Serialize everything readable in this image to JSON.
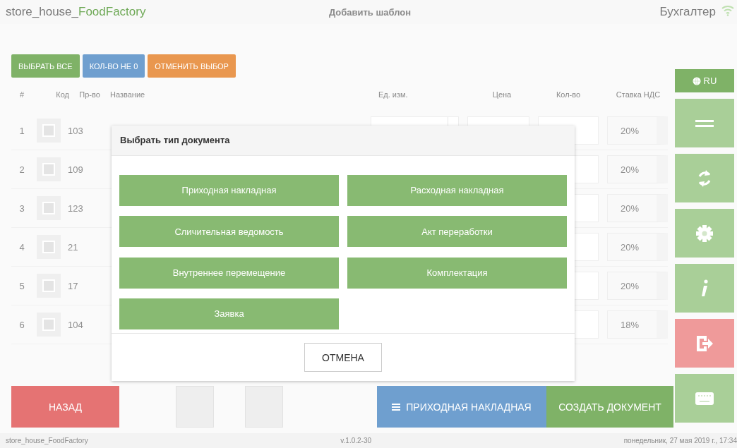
{
  "header": {
    "brand": "store_house_",
    "brand_accent": "FoodFactory",
    "title": "Добавить шаблон",
    "user": "Бухгалтер"
  },
  "toolbar": [
    {
      "label": "ВЫБРАТЬ ВСЕ",
      "color": "#7fb267"
    },
    {
      "label": "КОЛ-ВО НЕ 0",
      "color": "#6f9fcf"
    },
    {
      "label": "ОТМЕНИТЬ ВЫБОР",
      "color": "#e9974f"
    }
  ],
  "language": "RU",
  "table": {
    "columns": [
      "#",
      "Код",
      "Пр-во",
      "Название",
      "Ед. изм.",
      "Цена",
      "Кол-во",
      "Ставка НДС"
    ],
    "rows": [
      {
        "num": "1",
        "checked": false,
        "code": "103",
        "vat": "20%"
      },
      {
        "num": "2",
        "checked": false,
        "code": "109",
        "vat": "20%"
      },
      {
        "num": "3",
        "checked": false,
        "code": "123",
        "vat": "20%"
      },
      {
        "num": "4",
        "checked": false,
        "code": "21",
        "vat": "20%"
      },
      {
        "num": "5",
        "checked": false,
        "code": "17",
        "vat": "20%"
      },
      {
        "num": "6",
        "checked": false,
        "code": "104",
        "vat": "18%"
      }
    ]
  },
  "bottom_bar": {
    "back": "НАЗАД",
    "doc_type": "ПРИХОДНАЯ НАКЛАДНАЯ",
    "create": "СОЗДАТЬ ДОКУМЕНТ"
  },
  "dialog": {
    "title": "Выбрать тип документа",
    "options": [
      "Приходная накладная",
      "Расходная накладная",
      "Сличительная ведомость",
      "Акт переработки",
      "Внутреннее перемещение",
      "Комплектация",
      "Заявка"
    ],
    "cancel": "ОТМЕНА"
  },
  "status_bar": {
    "app": "store_house_FoodFactory",
    "version": "v.1.0.2-30",
    "datetime": "понедельник, 27 мая 2019 г., 17:34"
  }
}
